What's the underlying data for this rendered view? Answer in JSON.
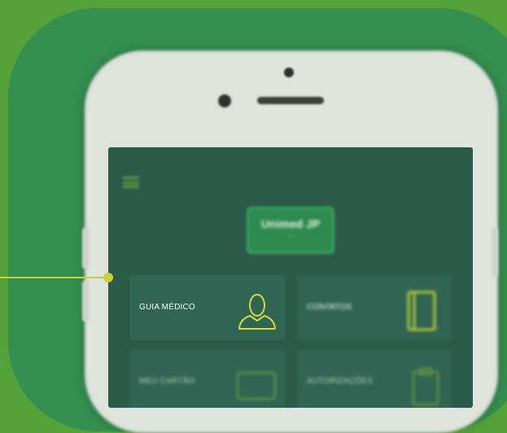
{
  "cards": [
    {
      "label": "GUIA MÉDICO",
      "icon": "doctor-icon"
    },
    {
      "label": "CONTATOS",
      "icon": "phonebook-icon"
    },
    {
      "label": "MEU CARTÃO",
      "icon": "card-icon"
    },
    {
      "label": "AUTORIZAÇÕES",
      "icon": "clipboard-icon"
    }
  ],
  "logo": {
    "text": "Unimed",
    "subtext": "JP"
  },
  "colors": {
    "background": "#55a23b",
    "tile": "#359050",
    "screen": "#2b5a49",
    "card": "#2f6552",
    "accent": "#c8d234",
    "icon": "#d7d83e"
  }
}
